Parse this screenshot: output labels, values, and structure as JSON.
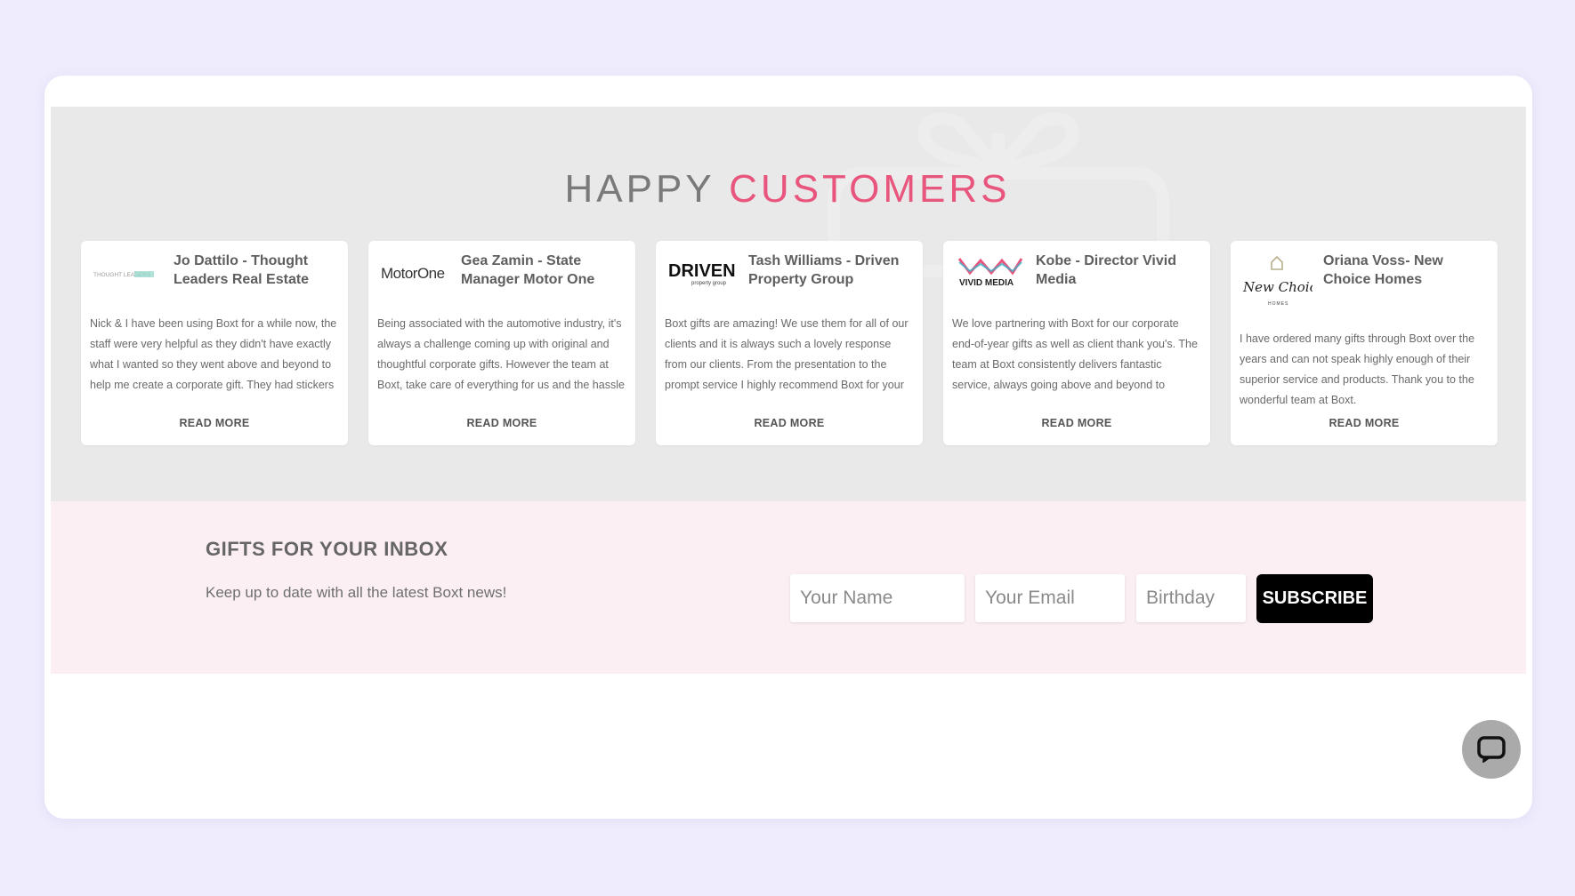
{
  "section": {
    "title_main": "HAPPY ",
    "title_accent": "CUSTOMERS"
  },
  "testimonials": [
    {
      "logo": "thought-leaders-logo",
      "logo_text": "THOUGHT LEADERS",
      "name": "Jo Dattilo - Thought Leaders Real Estate",
      "body": "Nick & I have been using Boxt for a while now, the staff were very helpful as they didn't have exactly what I wanted so they went above and beyond to help me create a corporate gift. They had stickers printed with our Company Logo",
      "read_more": "READ MORE"
    },
    {
      "logo": "motor-one-logo",
      "logo_text": "MotorOne",
      "name": "Gea Zamin - State Manager Motor One",
      "body": "Being associated with the automotive industry, it's always a challenge coming up with original and thoughtful corporate gifts. However the team at Boxt, take care of everything for us and the hassle is almost non existent! We have been",
      "read_more": "READ MORE"
    },
    {
      "logo": "driven-logo",
      "logo_text": "DRIVEN",
      "logo_subtext": "property group",
      "name": "Tash Williams - Driven Property Group",
      "body": "Boxt gifts are amazing! We use them for all of our clients and it is always such a lovely response from our clients. From the presentation to the prompt service I highly recommend Boxt for your gifting needs.",
      "read_more": "READ MORE"
    },
    {
      "logo": "vivid-media-logo",
      "logo_text": "VIVID MEDIA",
      "name": "Kobe - Director Vivid Media",
      "body": "We love partnering with Boxt for our corporate end-of-year gifts as well as client thank you's. The team at Boxt consistently delivers fantastic service, always going above and beyond to accommodate our needs. Their attention to detail",
      "read_more": "READ MORE"
    },
    {
      "logo": "new-choice-homes-logo",
      "logo_text": "New Choice",
      "logo_subtext": "HOMES",
      "name": "Oriana Voss- New Choice Homes",
      "body": "I have ordered many gifts through Boxt over the years and can not speak highly enough of their superior service and products. Thank you to the wonderful team at Boxt.",
      "read_more": "READ MORE"
    }
  ],
  "newsletter": {
    "title": "GIFTS FOR YOUR INBOX",
    "text": "Keep up to date with all the latest Boxt news!",
    "name_placeholder": "Your Name",
    "email_placeholder": "Your Email",
    "birthday_placeholder": "Birthday",
    "subscribe_label": "SUBSCRIBE"
  },
  "chat": {
    "icon": "chat-icon"
  },
  "colors": {
    "page_bg": "#efecfd",
    "section_bg": "#e9e9e9",
    "accent": "#e8557d",
    "newsletter_bg": "#fbeff3",
    "button_bg": "#000000"
  }
}
